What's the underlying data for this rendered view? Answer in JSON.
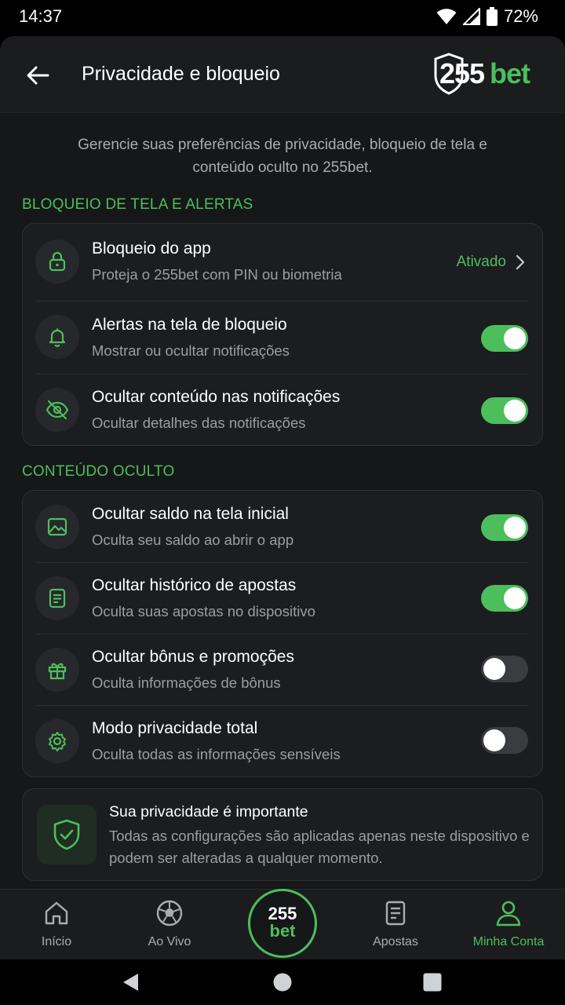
{
  "status_bar": {
    "time": "14:37",
    "battery": "72%"
  },
  "header": {
    "title": "Privacidade e bloqueio",
    "logo_number": "255",
    "logo_word": "bet"
  },
  "intro": "Gerencie suas preferências de privacidade, bloqueio de tela e conteúdo oculto no 255bet.",
  "sections": [
    {
      "label": "BLOQUEIO DE TELA E ALERTAS",
      "items": [
        {
          "title": "Bloqueio do app",
          "subtitle": "Proteja o 255bet com PIN ou biometria",
          "icon": "lock-icon",
          "control": "link",
          "status": "Ativado"
        },
        {
          "title": "Alertas na tela de bloqueio",
          "subtitle": "Mostrar ou ocultar notificações",
          "icon": "bell-icon",
          "control": "toggle",
          "on": true
        },
        {
          "title": "Ocultar conteúdo nas notificações",
          "subtitle": "Ocultar detalhes das notificações",
          "icon": "eye-off-icon",
          "control": "toggle",
          "on": true
        }
      ]
    },
    {
      "label": "CONTEÚDO OCULTO",
      "items": [
        {
          "title": "Ocultar saldo na tela inicial",
          "subtitle": "Oculta seu saldo ao abrir o app",
          "icon": "image-icon",
          "control": "toggle",
          "on": true
        },
        {
          "title": "Ocultar histórico de apostas",
          "subtitle": "Oculta suas apostas no dispositivo",
          "icon": "document-icon",
          "control": "toggle",
          "on": true
        },
        {
          "title": "Ocultar bônus e promoções",
          "subtitle": "Oculta informações de bônus",
          "icon": "gift-icon",
          "control": "toggle",
          "on": false
        },
        {
          "title": "Modo privacidade total",
          "subtitle": "Oculta todas as informações sensíveis",
          "icon": "gear-icon",
          "control": "toggle",
          "on": false
        }
      ]
    }
  ],
  "info": {
    "title": "Sua privacidade é importante",
    "text": "Todas as configurações são aplicadas apenas neste dispositivo e podem ser alteradas a qualquer momento.",
    "icon": "shield-check-icon"
  },
  "nav": {
    "items": [
      {
        "label": "Início",
        "icon": "home-icon",
        "active": false
      },
      {
        "label": "Ao Vivo",
        "icon": "soccer-ball-icon",
        "active": false
      },
      {
        "label": "Apostas",
        "icon": "bet-slip-icon",
        "active": false
      },
      {
        "label": "Minha Conta",
        "icon": "user-icon",
        "active": true
      }
    ],
    "center_top": "255",
    "center_bottom": "bet"
  },
  "colors": {
    "accent": "#4cbf5c",
    "background": "#161718",
    "card": "#1c1d20",
    "muted_text": "#9a9ea3"
  }
}
